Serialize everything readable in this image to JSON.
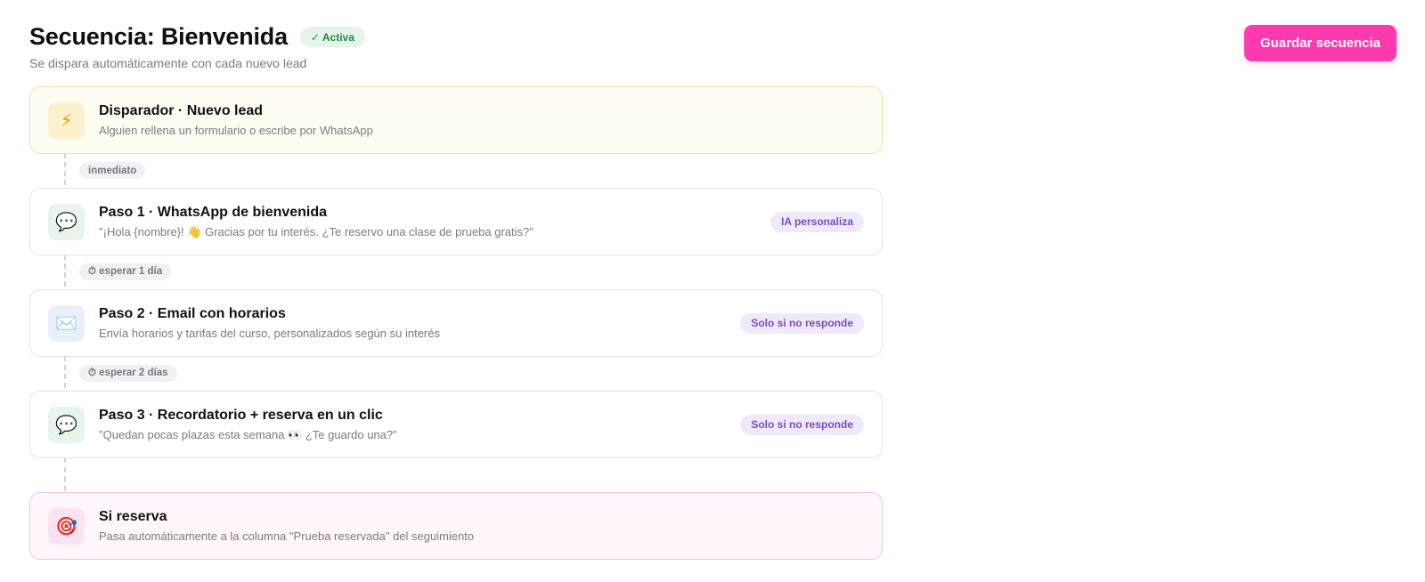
{
  "header": {
    "title": "Secuencia: Bienvenida",
    "status": "✓ Activa",
    "subtitle": "Se dispara automáticamente con cada nuevo lead",
    "save_label": "Guardar secuencia"
  },
  "trigger": {
    "icon": "lightning-icon",
    "title": "Disparador · Nuevo lead",
    "desc": "Alguien rellena un formulario o escribe por WhatsApp"
  },
  "delays": [
    "inmediato",
    "⏱ esperar 1 día",
    "⏱ esperar 2 días"
  ],
  "steps": [
    {
      "icon": "chat-icon",
      "title": "Paso 1 · WhatsApp de bienvenida",
      "desc": "\"¡Hola {nombre}! 👋 Gracias por tu interés. ¿Te reservo una clase de prueba gratis?\"",
      "tag": "IA personaliza"
    },
    {
      "icon": "mail-icon",
      "title": "Paso 2 · Email con horarios",
      "desc": "Envía horarios y tarifas del curso, personalizados según su interés",
      "tag": "Solo si no responde"
    },
    {
      "icon": "chat-icon",
      "title": "Paso 3 · Recordatorio + reserva en un clic",
      "desc": "\"Quedan pocas plazas esta semana 👀 ¿Te guardo una?\"",
      "tag": "Solo si no responde"
    }
  ],
  "goal": {
    "icon": "target-icon",
    "title": "Si reserva",
    "desc": "Pasa automáticamente a la columna \"Prueba reservada\" del seguimiento"
  },
  "colors": {
    "accent": "#ff3aae",
    "active_green": "#1f8a45",
    "tag_purple": "#7b4dc2"
  }
}
